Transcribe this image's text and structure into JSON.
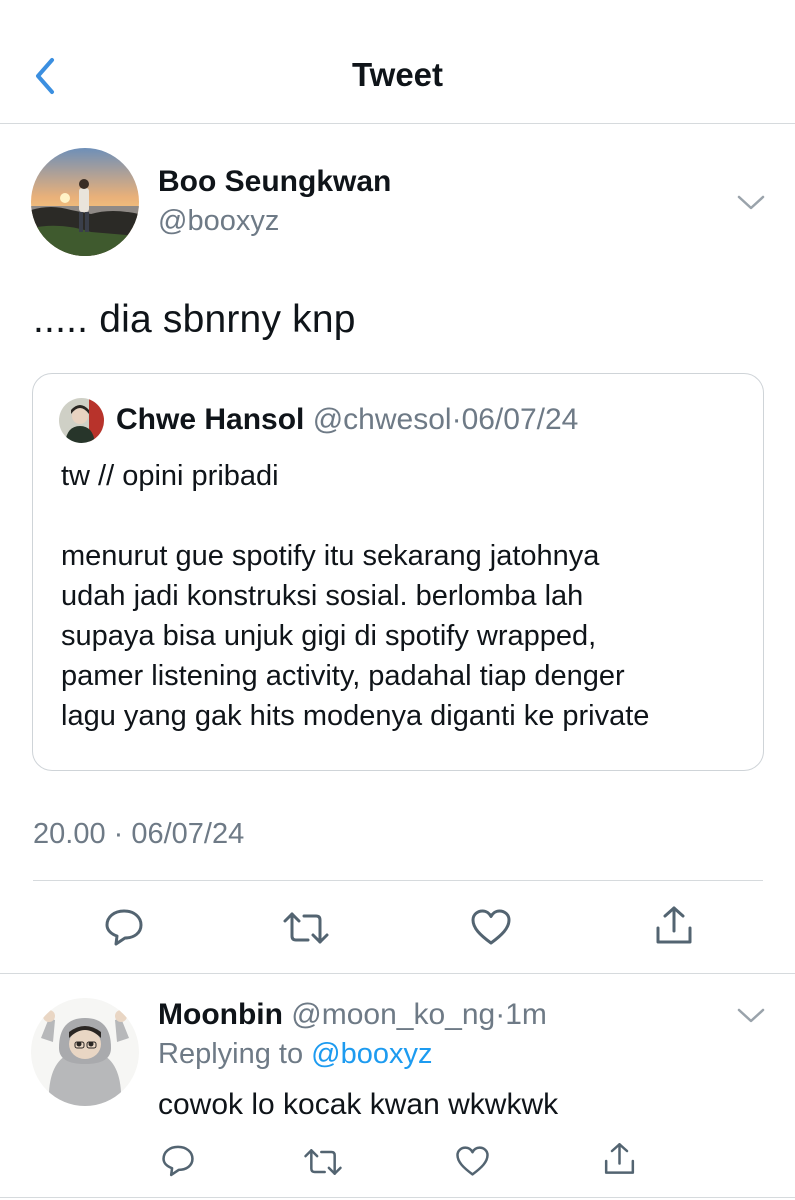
{
  "header": {
    "title": "Tweet",
    "back_icon": "chevron-left-icon",
    "accent": "#3b8fe0"
  },
  "tweet": {
    "author_name": "Boo Seungkwan",
    "author_handle": "@booxyz",
    "text": "..... dia sbnrny knp",
    "timestamp": "20.00 · 06/07/24",
    "quoted": {
      "author_name": "Chwe Hansol",
      "author_handle": "@chwesol",
      "separator": "·",
      "date": "06/07/24",
      "lines": [
        "tw // opini pribadi",
        "",
        "menurut gue spotify itu sekarang jatohnya",
        "udah jadi konstruksi sosial. berlomba lah",
        "supaya bisa unjuk gigi di spotify wrapped,",
        "pamer listening activity, padahal tiap denger",
        "lagu yang gak hits modenya diganti ke private"
      ]
    },
    "actions": [
      "reply-icon",
      "retweet-icon",
      "like-icon",
      "share-icon"
    ]
  },
  "reply": {
    "author_name": "Moonbin",
    "author_handle": "@moon_ko_ng",
    "separator": "·",
    "time": "1m",
    "replying_prefix": "Replying to",
    "replying_to": "@booxyz",
    "text": "cowok lo kocak kwan wkwkwk",
    "actions": [
      "reply-icon",
      "retweet-icon",
      "like-icon",
      "share-icon"
    ]
  },
  "colors": {
    "text": "#0f1419",
    "secondary": "#6e7a86",
    "link": "#1d9bf0",
    "divider": "#d6dadd"
  }
}
